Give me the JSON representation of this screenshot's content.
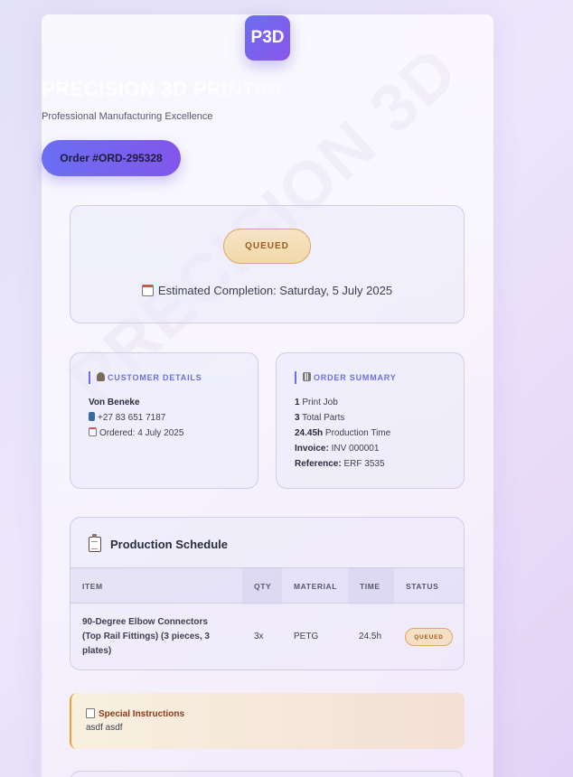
{
  "header": {
    "logo_text": "P3D",
    "title": "PRECISION 3D PRINTING",
    "subtitle": "Professional Manufacturing Excellence",
    "order_label": "Order #ORD-295328",
    "watermark": "PRECISION 3D"
  },
  "status": {
    "badge": "QUEUED",
    "estimated_completion": "Estimated Completion: Saturday, 5 July 2025"
  },
  "customer": {
    "heading": "CUSTOMER DETAILS",
    "name": "Von Beneke",
    "phone": "+27 83 651 7187",
    "ordered": "Ordered: 4 July 2025"
  },
  "summary": {
    "heading": "ORDER SUMMARY",
    "jobs_count": "1",
    "jobs_label": "Print Job",
    "parts_count": "3",
    "parts_label": "Total Parts",
    "production_hours": "24.45h",
    "production_label": "Production Time",
    "invoice_label": "Invoice:",
    "invoice_value": "INV 000001",
    "reference_label": "Reference:",
    "reference_value": "ERF 3535"
  },
  "schedule": {
    "title": "Production Schedule",
    "columns": [
      "ITEM",
      "QTY",
      "MATERIAL",
      "TIME",
      "STATUS"
    ],
    "rows": [
      {
        "item": "90-Degree Elbow Connectors (Top Rail Fittings) (3 pieces, 3 plates)",
        "qty": "3x",
        "material": "PETG",
        "time": "24.5h",
        "status": "QUEUED"
      }
    ]
  },
  "special_instructions": {
    "title": "Special Instructions",
    "body": "asdf asdf"
  },
  "colors": {
    "accent": "#6a6ff0",
    "accent_end": "#8256ec",
    "queued_bg": "#f0d9a8",
    "queued_text": "#a05a1c",
    "instructions_border": "#e7a23d"
  }
}
